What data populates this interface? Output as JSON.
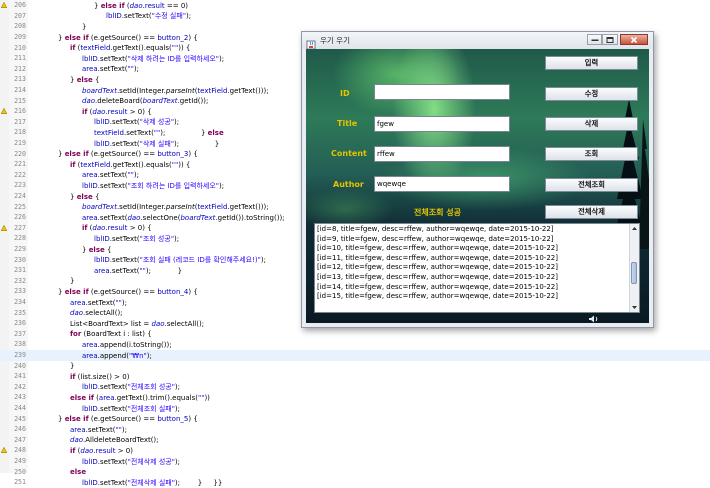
{
  "editor": {
    "lines": [
      {
        "n": "206",
        "mark": "warn",
        "indent": 6,
        "tokens": [
          [
            "",
            "} "
          ],
          [
            "kw",
            "else if"
          ],
          [
            "",
            " ("
          ],
          [
            "it",
            "dao"
          ],
          [
            "",
            "."
          ],
          [
            "fld",
            "result"
          ],
          [
            "",
            " == 0)"
          ]
        ]
      },
      {
        "n": "207",
        "indent": 7,
        "tokens": [
          [
            "fld",
            "lblID"
          ],
          [
            "",
            ".setText("
          ],
          [
            "str",
            "\"수정 실패\""
          ],
          [
            "",
            ");"
          ]
        ]
      },
      {
        "n": "208",
        "indent": 5,
        "tokens": [
          [
            "",
            "}"
          ]
        ]
      },
      {
        "n": "209",
        "indent": 3,
        "tokens": [
          [
            "",
            "} "
          ],
          [
            "kw",
            "else if"
          ],
          [
            "",
            " (e.getSource() == "
          ],
          [
            "fld",
            "button_2"
          ],
          [
            "",
            ") {"
          ]
        ]
      },
      {
        "n": "210",
        "indent": 4,
        "tokens": [
          [
            "kw",
            "if"
          ],
          [
            "",
            " ("
          ],
          [
            "fld",
            "textField"
          ],
          [
            "",
            ".getText().equals("
          ],
          [
            "str",
            "\"\""
          ],
          [
            "",
            ")) {"
          ]
        ]
      },
      {
        "n": "211",
        "indent": 5,
        "tokens": [
          [
            "fld",
            "lblID"
          ],
          [
            "",
            ".setText("
          ],
          [
            "str",
            "\"삭제 하려는 ID를 입력하세오\""
          ],
          [
            "",
            ");"
          ]
        ]
      },
      {
        "n": "212",
        "indent": 5,
        "tokens": [
          [
            "fld",
            "area"
          ],
          [
            "",
            ".setText("
          ],
          [
            "str",
            "\"\""
          ],
          [
            "",
            ");"
          ]
        ]
      },
      {
        "n": "213",
        "indent": 4,
        "tokens": [
          [
            "",
            "} "
          ],
          [
            "kw",
            "else"
          ],
          [
            "",
            " {"
          ]
        ]
      },
      {
        "n": "214",
        "indent": 5,
        "tokens": [
          [
            "it",
            "boardText"
          ],
          [
            "",
            ".setId(Integer."
          ],
          [
            "itb",
            "parseInt"
          ],
          [
            "",
            "("
          ],
          [
            "fld",
            "textField"
          ],
          [
            "",
            ".getText()));"
          ]
        ]
      },
      {
        "n": "215",
        "indent": 5,
        "tokens": [
          [
            "it",
            "dao"
          ],
          [
            "",
            ".deleteBoard("
          ],
          [
            "it",
            "boardText"
          ],
          [
            "",
            ".getId());"
          ]
        ]
      },
      {
        "n": "216",
        "mark": "warn",
        "indent": 5,
        "tokens": [
          [
            "kw",
            "if"
          ],
          [
            "",
            " ("
          ],
          [
            "it",
            "dao"
          ],
          [
            "",
            "."
          ],
          [
            "fld",
            "result"
          ],
          [
            "",
            " > 0) {"
          ]
        ]
      },
      {
        "n": "217",
        "indent": 6,
        "tokens": [
          [
            "fld",
            "lblID"
          ],
          [
            "",
            ".setText("
          ],
          [
            "str",
            "\"삭제 성공\""
          ],
          [
            "",
            ");"
          ]
        ]
      },
      {
        "n": "218",
        "indent": 6,
        "tokens": [
          [
            "fld",
            "textField"
          ],
          [
            "",
            ".setText("
          ],
          [
            "str",
            "\"\""
          ],
          [
            "",
            ");                } "
          ],
          [
            "kw",
            "else"
          ]
        ]
      },
      {
        "n": "219",
        "indent": 6,
        "tokens": [
          [
            "fld",
            "lblID"
          ],
          [
            "",
            ".setText("
          ],
          [
            "str",
            "\"삭제 실패\""
          ],
          [
            "",
            ");                }"
          ]
        ]
      },
      {
        "n": "220",
        "indent": 3,
        "tokens": [
          [
            "",
            "} "
          ],
          [
            "kw",
            "else if"
          ],
          [
            "",
            " (e.getSource() == "
          ],
          [
            "fld",
            "button_3"
          ],
          [
            "",
            ") {"
          ]
        ]
      },
      {
        "n": "221",
        "indent": 4,
        "tokens": [
          [
            "kw",
            "if"
          ],
          [
            "",
            " ("
          ],
          [
            "fld",
            "textField"
          ],
          [
            "",
            ".getText().equals("
          ],
          [
            "str",
            "\"\""
          ],
          [
            "",
            ")) {"
          ]
        ]
      },
      {
        "n": "222",
        "indent": 5,
        "tokens": [
          [
            "fld",
            "area"
          ],
          [
            "",
            ".setText("
          ],
          [
            "str",
            "\"\""
          ],
          [
            "",
            ");"
          ]
        ]
      },
      {
        "n": "223",
        "indent": 5,
        "tokens": [
          [
            "fld",
            "lblID"
          ],
          [
            "",
            ".setText("
          ],
          [
            "str",
            "\"조회 하려는 ID를 입력하세오\""
          ],
          [
            "",
            ");"
          ]
        ]
      },
      {
        "n": "224",
        "indent": 4,
        "tokens": [
          [
            "",
            "} "
          ],
          [
            "kw",
            "else"
          ],
          [
            "",
            " {"
          ]
        ]
      },
      {
        "n": "225",
        "indent": 5,
        "tokens": [
          [
            "it",
            "boardText"
          ],
          [
            "",
            ".setId(Integer."
          ],
          [
            "itb",
            "parseInt"
          ],
          [
            "",
            "("
          ],
          [
            "fld",
            "textField"
          ],
          [
            "",
            ".getText()));"
          ]
        ]
      },
      {
        "n": "226",
        "indent": 5,
        "tokens": [
          [
            "fld",
            "area"
          ],
          [
            "",
            ".setText("
          ],
          [
            "it",
            "dao"
          ],
          [
            "",
            ".selectOne("
          ],
          [
            "it",
            "boardText"
          ],
          [
            "",
            ".getId()).toString());"
          ]
        ]
      },
      {
        "n": "227",
        "mark": "warn",
        "indent": 5,
        "tokens": [
          [
            "kw",
            "if"
          ],
          [
            "",
            " ("
          ],
          [
            "it",
            "dao"
          ],
          [
            "",
            "."
          ],
          [
            "fld",
            "result"
          ],
          [
            "",
            " > 0) {"
          ]
        ]
      },
      {
        "n": "228",
        "indent": 6,
        "tokens": [
          [
            "fld",
            "lblID"
          ],
          [
            "",
            ".setText("
          ],
          [
            "str",
            "\"조회 성공\""
          ],
          [
            "",
            ");"
          ]
        ]
      },
      {
        "n": "229",
        "indent": 5,
        "tokens": [
          [
            "",
            "} "
          ],
          [
            "kw",
            "else"
          ],
          [
            "",
            " {"
          ]
        ]
      },
      {
        "n": "230",
        "indent": 6,
        "tokens": [
          [
            "fld",
            "lblID"
          ],
          [
            "",
            ".setText("
          ],
          [
            "str",
            "\"조회 실패 (레코드 ID를 확인해주세요!)\""
          ],
          [
            "",
            ");"
          ]
        ]
      },
      {
        "n": "231",
        "indent": 6,
        "tokens": [
          [
            "fld",
            "area"
          ],
          [
            "",
            ".setText("
          ],
          [
            "str",
            "\"\""
          ],
          [
            "",
            ");            }"
          ]
        ]
      },
      {
        "n": "232",
        "indent": 4,
        "tokens": [
          [
            "",
            "}"
          ]
        ]
      },
      {
        "n": "233",
        "indent": 3,
        "tokens": [
          [
            "",
            "} "
          ],
          [
            "kw",
            "else if"
          ],
          [
            "",
            " (e.getSource() == "
          ],
          [
            "fld",
            "button_4"
          ],
          [
            "",
            ") {"
          ]
        ]
      },
      {
        "n": "234",
        "indent": 4,
        "tokens": [
          [
            "fld",
            "area"
          ],
          [
            "",
            ".setText("
          ],
          [
            "str",
            "\"\""
          ],
          [
            "",
            ");"
          ]
        ]
      },
      {
        "n": "235",
        "indent": 4,
        "tokens": [
          [
            "it",
            "dao"
          ],
          [
            "",
            ".selectAll();"
          ]
        ]
      },
      {
        "n": "236",
        "indent": 4,
        "tokens": [
          [
            "",
            "List<BoardText> "
          ],
          [
            "",
            "list"
          ],
          [
            "",
            " = "
          ],
          [
            "it",
            "dao"
          ],
          [
            "",
            ".selectAll();"
          ]
        ]
      },
      {
        "n": "237",
        "indent": 4,
        "tokens": [
          [
            "kw",
            "for"
          ],
          [
            "",
            " (BoardText i : "
          ],
          [
            "",
            "list"
          ],
          [
            "",
            ") {"
          ]
        ]
      },
      {
        "n": "238",
        "indent": 5,
        "tokens": [
          [
            "fld",
            "area"
          ],
          [
            "",
            ".append(i.toString());"
          ]
        ]
      },
      {
        "n": "239",
        "hl": true,
        "indent": 5,
        "tokens": [
          [
            "fld",
            "area"
          ],
          [
            "",
            ".append("
          ],
          [
            "str",
            "\"₩n\""
          ],
          [
            "",
            ");"
          ]
        ]
      },
      {
        "n": "240",
        "indent": 4,
        "tokens": [
          [
            "",
            "}"
          ]
        ]
      },
      {
        "n": "241",
        "indent": 4,
        "tokens": [
          [
            "kw",
            "if"
          ],
          [
            "",
            " (list.size() > 0)"
          ]
        ]
      },
      {
        "n": "242",
        "indent": 5,
        "tokens": [
          [
            "fld",
            "lblID"
          ],
          [
            "",
            ".setText("
          ],
          [
            "str",
            "\"전체조회 성공\""
          ],
          [
            "",
            ");"
          ]
        ]
      },
      {
        "n": "243",
        "indent": 4,
        "tokens": [
          [
            "kw",
            "else if"
          ],
          [
            "",
            " ("
          ],
          [
            "fld",
            "area"
          ],
          [
            "",
            ".getText().trim().equals("
          ],
          [
            "str",
            "\"\""
          ],
          [
            "",
            "))"
          ]
        ]
      },
      {
        "n": "244",
        "indent": 5,
        "tokens": [
          [
            "fld",
            "lblID"
          ],
          [
            "",
            ".setText("
          ],
          [
            "str",
            "\"전체조회 실패\""
          ],
          [
            "",
            ");"
          ]
        ]
      },
      {
        "n": "245",
        "indent": 3,
        "tokens": [
          [
            "",
            "} "
          ],
          [
            "kw",
            "else if"
          ],
          [
            "",
            " (e.getSource() == "
          ],
          [
            "fld",
            "button_5"
          ],
          [
            "",
            ") {"
          ]
        ]
      },
      {
        "n": "246",
        "indent": 4,
        "tokens": [
          [
            "fld",
            "area"
          ],
          [
            "",
            ".setText("
          ],
          [
            "str",
            "\"\""
          ],
          [
            "",
            ");"
          ]
        ]
      },
      {
        "n": "247",
        "indent": 4,
        "tokens": [
          [
            "it",
            "dao"
          ],
          [
            "",
            ".AlldeleteBoardText();"
          ]
        ]
      },
      {
        "n": "248",
        "mark": "warn",
        "indent": 4,
        "tokens": [
          [
            "kw",
            "if"
          ],
          [
            "",
            " ("
          ],
          [
            "it",
            "dao"
          ],
          [
            "",
            "."
          ],
          [
            "fld",
            "result"
          ],
          [
            "",
            " > 0)"
          ]
        ]
      },
      {
        "n": "249",
        "indent": 5,
        "tokens": [
          [
            "fld",
            "lblID"
          ],
          [
            "",
            ".setText("
          ],
          [
            "str",
            "\"전체삭제 성공\""
          ],
          [
            "",
            ");"
          ]
        ]
      },
      {
        "n": "250",
        "indent": 4,
        "tokens": [
          [
            "kw",
            "else"
          ]
        ]
      },
      {
        "n": "251",
        "indent": 5,
        "tokens": [
          [
            "fld",
            "lblID"
          ],
          [
            "",
            ".setText("
          ],
          [
            "str",
            "\"전체삭제 실패\""
          ],
          [
            "",
            ");        }     }}"
          ]
        ]
      }
    ]
  },
  "window": {
    "title": "우기 우기",
    "labels": {
      "id": "ID",
      "title": "Title",
      "content": "Content",
      "author": "Author"
    },
    "fields": {
      "id": "",
      "title": "fgew",
      "content": "rffew",
      "author": "wqewqe"
    },
    "buttons": {
      "insert": "입력",
      "update": "수정",
      "delete": "삭제",
      "select": "조회",
      "select_all": "전체조회",
      "delete_all": "전체삭제"
    },
    "status": "전체조회 성공",
    "area_lines": [
      "[id=8, title=fgew, desc=rffew, author=wqewqe, date=2015-10-22]",
      "[id=9, title=fgew, desc=rffew, author=wqewqe, date=2015-10-22]",
      "[id=10, title=fgew, desc=rffew, author=wqewqe, date=2015-10-22]",
      "[id=11, title=fgew, desc=rffew, author=wqewqe, date=2015-10-22]",
      "[id=12, title=fgew, desc=rffew, author=wqewqe, date=2015-10-22]",
      "[id=13, title=fgew, desc=rffew, author=wqewqe, date=2015-10-22]",
      "[id=14, title=fgew, desc=rffew, author=wqewqe, date=2015-10-22]",
      "[id=15, title=fgew, desc=rffew, author=wqewqe, date=2015-10-22]"
    ],
    "icons": {
      "app": "java-cup-icon",
      "minimize": "minimize-icon",
      "maximize": "maximize-icon",
      "close": "close-icon"
    }
  }
}
